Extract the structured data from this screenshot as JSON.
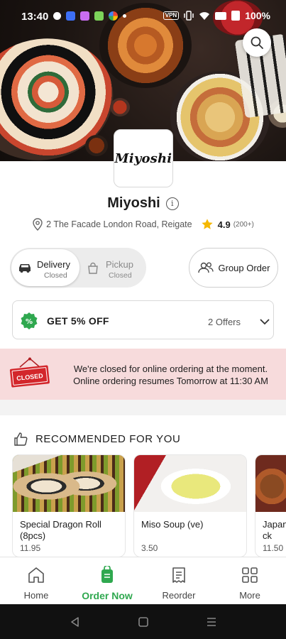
{
  "status_bar": {
    "time": "13:40",
    "vpn": "VPN",
    "battery": "100%"
  },
  "restaurant": {
    "logo_text": "Miyoshi",
    "name": "Miyoshi",
    "address": "2 The Facade London Road, Reigate",
    "rating": "4.9",
    "rating_count": "(200+)"
  },
  "order_mode": {
    "delivery": {
      "label": "Delivery",
      "status": "Closed"
    },
    "pickup": {
      "label": "Pickup",
      "status": "Closed"
    },
    "group_order": "Group Order"
  },
  "offers": {
    "title": "GET 5% OFF",
    "count": "2 Offers"
  },
  "closed_banner": {
    "sign_text": "CLOSED",
    "line1": "We're closed for online ordering at the moment.",
    "line2": "Online ordering resumes Tomorrow at 11:30 AM"
  },
  "recommended": {
    "title": "RECOMMENDED FOR YOU",
    "items": [
      {
        "name": "Special Dragon Roll (8pcs)",
        "price": "11.95"
      },
      {
        "name": "Miso Soup (ve)",
        "price": "3.50"
      },
      {
        "name": "Japan Chick",
        "price": "11.50"
      }
    ]
  },
  "bottom_nav": [
    {
      "label": "Home",
      "icon": "home-icon",
      "active": false
    },
    {
      "label": "Order Now",
      "icon": "order-bag-icon",
      "active": true
    },
    {
      "label": "Reorder",
      "icon": "receipt-icon",
      "active": false
    },
    {
      "label": "More",
      "icon": "grid-icon",
      "active": false
    }
  ],
  "colors": {
    "accent": "#2fa84f",
    "closed_bg": "#f7dbdc",
    "closed_sign": "#d3262b",
    "star": "#f5b800"
  }
}
